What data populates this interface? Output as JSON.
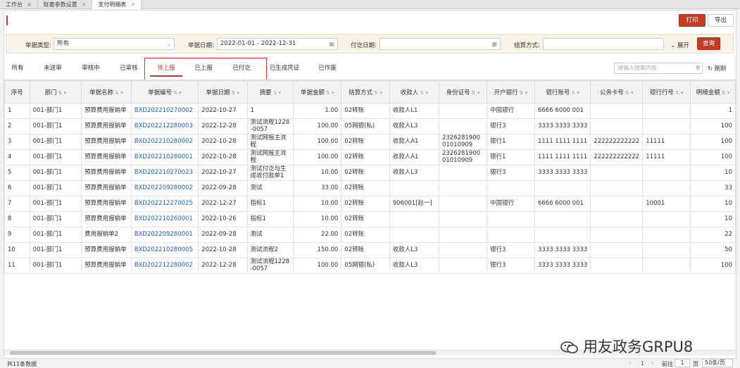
{
  "tabs": [
    {
      "label": "工作台",
      "active": false
    },
    {
      "label": "账套参数设置",
      "active": false
    },
    {
      "label": "支付明细表",
      "active": true
    }
  ],
  "toolbar": {
    "print": "打印",
    "export": "导出"
  },
  "filters": {
    "doc_type_label": "单据类型:",
    "doc_type_value": "所有",
    "doc_date_label": "单据日期:",
    "doc_date_value": "2022-01-01 - 2022-12-31",
    "pay_date_label": "付讫日期:",
    "pay_date_value": "",
    "settle_label": "结算方式:",
    "settle_value": "",
    "expand": "展开",
    "query": "查询"
  },
  "status_tabs": [
    "所有",
    "未送审",
    "审核中",
    "已审核",
    "待上报",
    "已上报",
    "已付讫",
    "已生成凭证",
    "已作废"
  ],
  "active_status": "待上报",
  "search": {
    "placeholder": "请输入搜索内容"
  },
  "refresh": "刷新",
  "columns": [
    "序号",
    "部门",
    "单据名称",
    "单据编号",
    "单据日期",
    "摘要",
    "单据金额",
    "结算方式",
    "收款人",
    "身份证号",
    "开户银行",
    "银行账号",
    "公务卡号",
    "银行行号",
    "明细金额"
  ],
  "rows": [
    [
      "1",
      "001-部门1",
      "预算费用报销单",
      "BXD202210270002",
      "2022-10-27",
      "1",
      "1.00",
      "02转账",
      "收款人L1",
      "",
      "中国银行",
      "6666 6000 001",
      "",
      "",
      "1"
    ],
    [
      "2",
      "001-部门1",
      "预算费用报销单",
      "BXD202212280003",
      "2022-12-28",
      "测试流程1228-0057",
      "100.00",
      "05网银(私)",
      "收款人L3",
      "",
      "银行3",
      "3333 3333 3333",
      "",
      "",
      "100"
    ],
    [
      "3",
      "001-部门1",
      "预算费用报销单",
      "BXD202210280002",
      "2022-10-28",
      "测试网报主流程",
      "100.00",
      "02转账",
      "收款人A1",
      "232628190001010909",
      "银行1",
      "1111 1111 1111",
      "222222222222",
      "11111",
      "100"
    ],
    [
      "4",
      "001-部门1",
      "预算费用报销单",
      "BXD202210280001",
      "2022-10-28",
      "测试网报主流程",
      "100.00",
      "02转账",
      "收款人A1",
      "232628190001010909",
      "银行1",
      "1111 1111 1111",
      "222222222222",
      "11111",
      "100"
    ],
    [
      "5",
      "001-部门1",
      "预算费用报销单",
      "BXD202210270023",
      "2022-10-27",
      "测试付讫与生成收付款单1",
      "10.00",
      "02转账",
      "收款人L3",
      "",
      "银行3",
      "3333 3333 3333",
      "",
      "",
      "10"
    ],
    [
      "6",
      "001-部门1",
      "预算费用报销单",
      "BXD202209280002",
      "2022-09-28",
      "测试",
      "33.00",
      "02转账",
      "",
      "",
      "",
      "",
      "",
      "",
      "33"
    ],
    [
      "7",
      "001-部门1",
      "预算费用报销单",
      "BXD202212270025",
      "2022-12-27",
      "指标1",
      "10.00",
      "02转账",
      "906001[赵一]",
      "",
      "中国银行",
      "6666 6000 001",
      "",
      "10001",
      "10"
    ],
    [
      "8",
      "001-部门1",
      "预算费用报销单",
      "BXD202210260001",
      "2022-10-26",
      "指标1",
      "10.00",
      "02转账",
      "",
      "",
      "",
      "",
      "",
      "",
      "10"
    ],
    [
      "9",
      "001-部门1",
      "费用报销单2",
      "BXD202209280001",
      "2022-09-28",
      "测试",
      "22.00",
      "02转账",
      "",
      "",
      "",
      "",
      "",
      "",
      "22"
    ],
    [
      "10",
      "001-部门1",
      "预算费用报销单",
      "BXD202210280005",
      "2022-10-28",
      "测试流程2",
      "150.00",
      "02转账",
      "收款人L3",
      "",
      "银行3",
      "3333 3333 3333",
      "",
      "",
      "50"
    ],
    [
      "11",
      "001-部门1",
      "预算费用报销单",
      "BXD202212280002",
      "2022-12-28",
      "测试流程1228-0057",
      "100.00",
      "05网银(私)",
      "收款人L3",
      "",
      "银行3",
      "3333 3333 3333",
      "",
      "",
      "100"
    ]
  ],
  "footer": {
    "total": "共11条数据",
    "page": "1",
    "goto_label": "前往",
    "goto_value": "1",
    "page_unit": "页",
    "page_size": "50条/页"
  },
  "watermark": "用友政务GRPU8",
  "colors": {
    "accent": "#c23b22",
    "link": "#1a5fb4",
    "highlight_box": "#ee2222"
  }
}
